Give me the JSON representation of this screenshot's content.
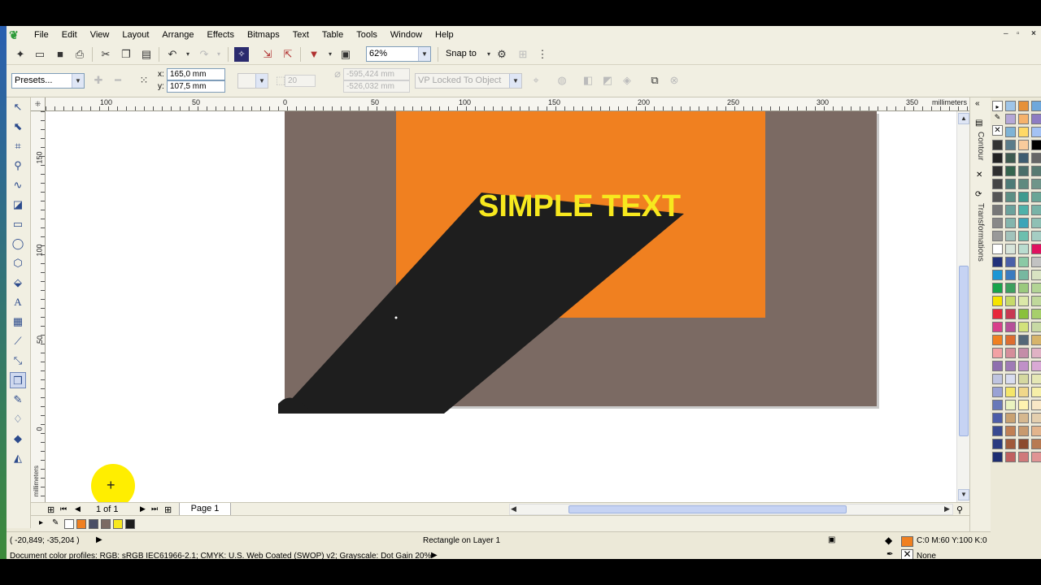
{
  "menu": {
    "items": [
      "File",
      "Edit",
      "View",
      "Layout",
      "Arrange",
      "Effects",
      "Bitmaps",
      "Text",
      "Table",
      "Tools",
      "Window",
      "Help"
    ]
  },
  "window_controls": [
    "–",
    "▫",
    "×"
  ],
  "toolbar": {
    "zoom_value": "62%",
    "snap_label": "Snap to"
  },
  "propertybar": {
    "presets_value": "Presets...",
    "x_label": "x:",
    "x_value": "165,0 mm",
    "y_label": "y:",
    "y_value": "107,5 mm",
    "depth_value": "20",
    "vp_x_value": "-595,424 mm",
    "vp_y_value": "-526,032 mm",
    "vp_lock_value": "VP Locked To Object"
  },
  "rulers": {
    "units": "millimeters",
    "h_ticks": [
      "100",
      "50",
      "0",
      "50",
      "100",
      "150",
      "200",
      "250",
      "300",
      "350"
    ],
    "v_ticks": [
      "150",
      "100",
      "50",
      "0"
    ]
  },
  "canvas": {
    "text": "SIMPLE TEXT",
    "background_color": "#7b6a63",
    "rect_color": "#f08020",
    "extrude_color": "#1e1e1e",
    "text_color": "#f7e81e"
  },
  "pages": {
    "counter": "1 of 1",
    "tab_label": "Page 1"
  },
  "docker": {
    "contour_label": "Contour",
    "transformations_label": "Transformations"
  },
  "doc_swatches": [
    "#f08020",
    "#4a4f66",
    "#7b6a63",
    "#f7e81e",
    "#1e1e1e"
  ],
  "status": {
    "coords": "( -20,849; -35,204 )",
    "object_info": "Rectangle on Layer 1",
    "fill_info": "C:0 M:60 Y:100 K:0",
    "outline_info": "None",
    "color_profiles": "Document color profiles: RGB: sRGB IEC61966-2.1; CMYK: U.S. Web Coated (SWOP) v2; Grayscale: Dot Gain 20%"
  },
  "palette_colors": [
    "#ffffff",
    "#9fc5e8",
    "#e69138",
    "#6fa8dc",
    "#000000",
    "#b4a7d6",
    "#f6b26b",
    "#8e7cc3",
    "#e8e8e8",
    "#7fb3d5",
    "#ffd966",
    "#a4c2f4",
    "#333333",
    "#5b7c8a",
    "#f9cb9c",
    "#000000",
    "#222222",
    "#3e5a4f",
    "#3d5c70",
    "#666666",
    "#2f2f2f",
    "#35644e",
    "#4a6e6a",
    "#587a71",
    "#444444",
    "#4d7a76",
    "#5f8a7f",
    "#6f958a",
    "#555555",
    "#5c8f84",
    "#3f9a8f",
    "#6aa596",
    "#777777",
    "#6ba29c",
    "#4fb1a9",
    "#78b3a7",
    "#888888",
    "#84b5ad",
    "#3ca5b8",
    "#8fc0b4",
    "#999999",
    "#a2c3bb",
    "#6cbfae",
    "#a5cdc3",
    "#ffffff",
    "#d7e4da",
    "#b9dccf",
    "#e0115f",
    "#22317a",
    "#4a5fa8",
    "#8bc9a5",
    "#c2c2c2",
    "#1c96d4",
    "#3b7bbf",
    "#77b8a0",
    "#d8e3c2",
    "#17a34a",
    "#3d9f5e",
    "#9ac97d",
    "#b3d495",
    "#f5e400",
    "#c6da6a",
    "#dbe8a8",
    "#c0d89b",
    "#e8283a",
    "#c83952",
    "#8ac13c",
    "#a7cf6b",
    "#d83f8a",
    "#b65198",
    "#d2e27a",
    "#c8d9a4",
    "#f08020",
    "#dd6d30",
    "#546878",
    "#d6b46a",
    "#f2a1a3",
    "#d58e9a",
    "#c48da8",
    "#e0b2c4",
    "#8f6fae",
    "#a07bb6",
    "#c090c8",
    "#d9a9d5",
    "#bfc4e0",
    "#d8dcef",
    "#d5d8a0",
    "#e5e7b5",
    "#9aa2d4",
    "#f5e66a",
    "#f0d78a",
    "#f6efa8",
    "#6878b8",
    "#eaf3c0",
    "#fff3b0",
    "#f8e7c6",
    "#4d5da8",
    "#c9a272",
    "#d6b88f",
    "#e4cfae",
    "#384990",
    "#c08055",
    "#c89a6e",
    "#e2b48c",
    "#2a3a80",
    "#a05a3a",
    "#8c4a2e",
    "#b87a52",
    "#1d2d70",
    "#c06060",
    "#d07a7a",
    "#e09494"
  ]
}
